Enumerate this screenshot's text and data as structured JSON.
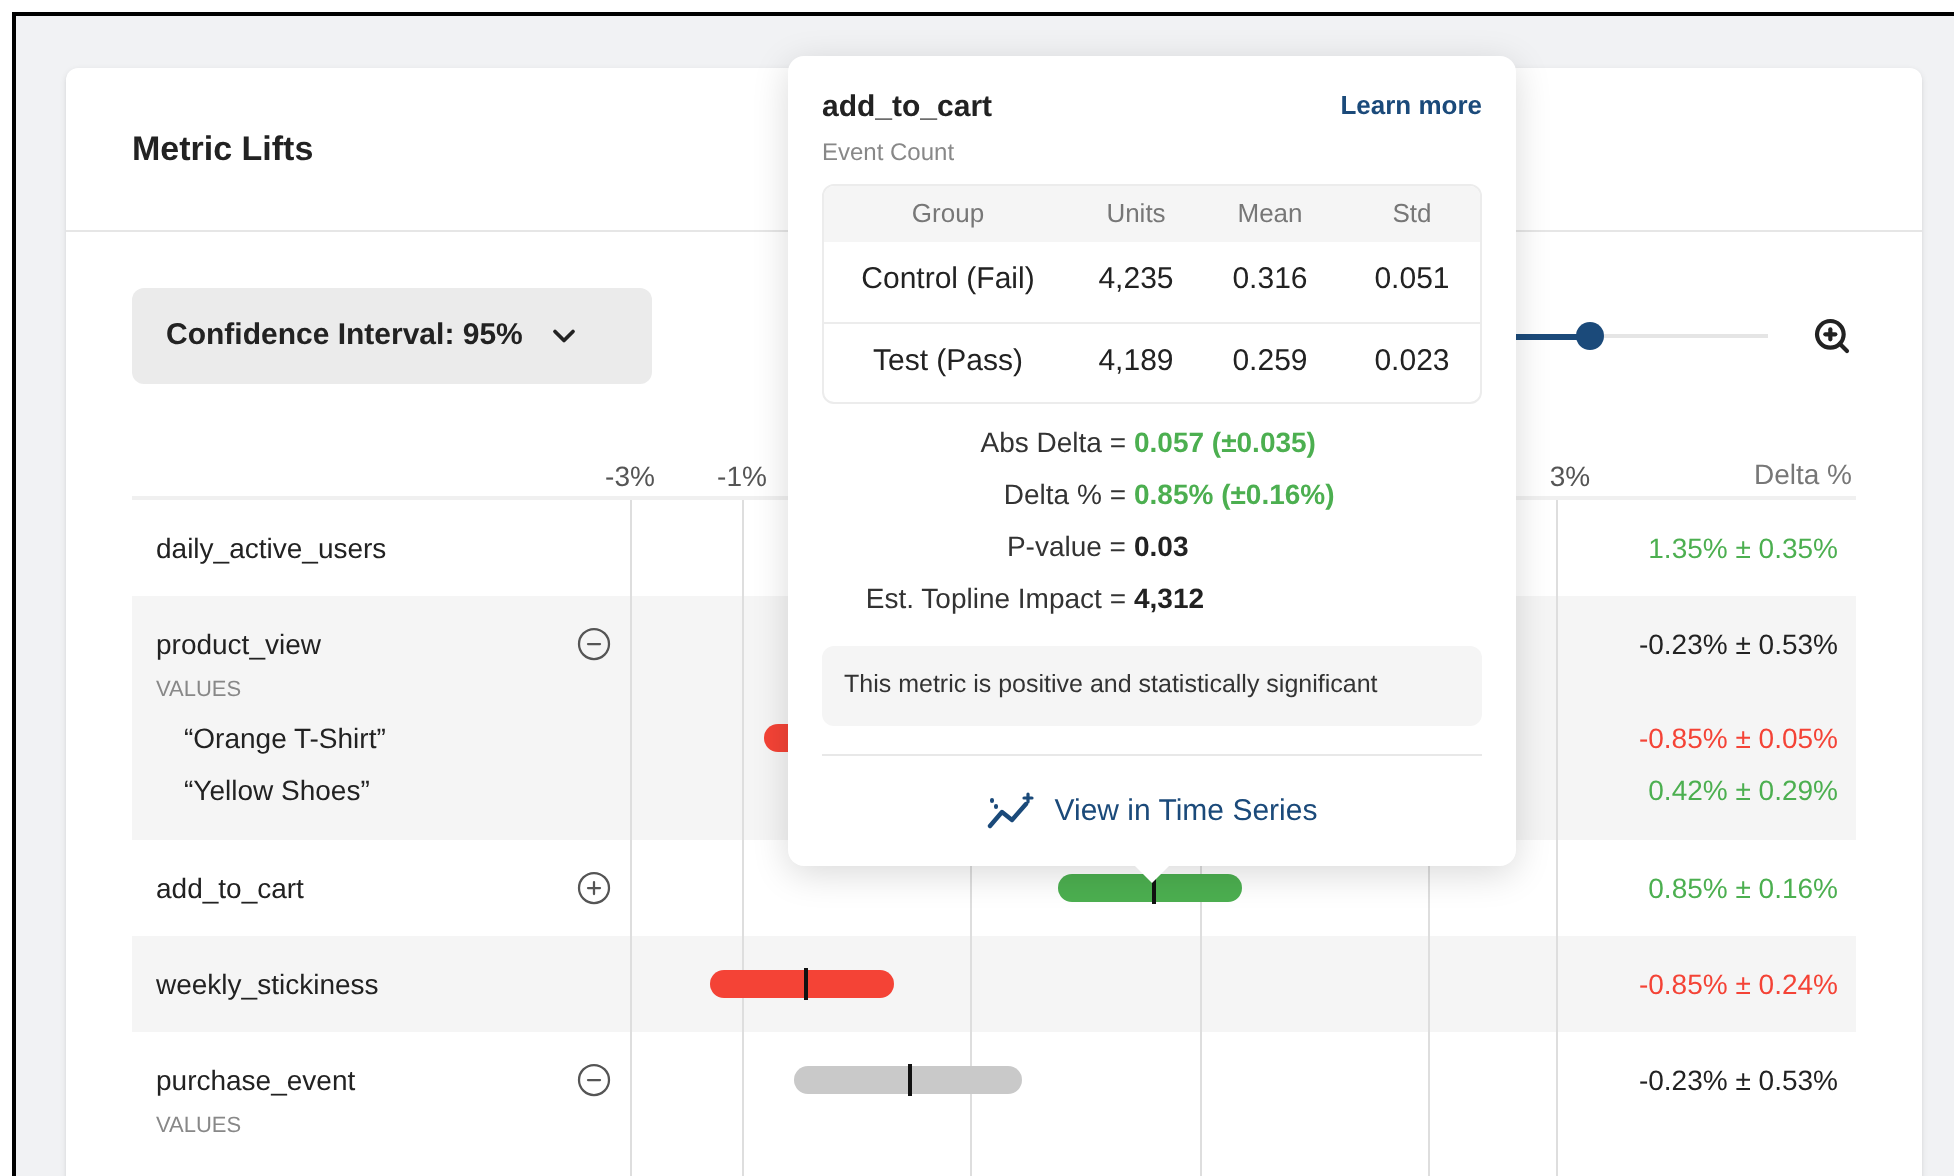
{
  "card": {
    "title": "Metric Lifts"
  },
  "confidence_dropdown": {
    "label": "Confidence Interval: 95%"
  },
  "zoom_slider": {
    "level": 0.68
  },
  "axis": {
    "ticks": [
      "-3%",
      "-1%",
      "3%"
    ],
    "delta_heading": "Delta %"
  },
  "rows": [
    {
      "name": "daily_active_users",
      "kind": "plain",
      "delta": "1.35% ± 0.35%",
      "color": "#4caf50"
    },
    {
      "name": "product_view",
      "kind": "group",
      "expanded": true,
      "delta": "-0.23% ± 0.53%",
      "color": "#222222",
      "values_label": "VALUES",
      "values": [
        {
          "name": "“Orange T-Shirt”",
          "delta": "-0.85% ± 0.05%",
          "color": "#f44336",
          "bar": {
            "color": "#f44336"
          }
        },
        {
          "name": "“Yellow Shoes”",
          "delta": "0.42% ± 0.29%",
          "color": "#4caf50"
        }
      ]
    },
    {
      "name": "add_to_cart",
      "kind": "group",
      "expanded": false,
      "delta": "0.85% ± 0.16%",
      "color": "#4caf50",
      "bar": {
        "color": "#4caf50"
      }
    },
    {
      "name": "weekly_stickiness",
      "kind": "plain",
      "delta": "-0.85% ± 0.24%",
      "color": "#f44336",
      "bar": {
        "color": "#f44336"
      }
    },
    {
      "name": "purchase_event",
      "kind": "group",
      "expanded": true,
      "delta": "-0.23% ± 0.53%",
      "color": "#222222",
      "bar": {
        "color": "#c9c9c9"
      },
      "values_label": "VALUES"
    }
  ],
  "popover": {
    "title": "add_to_cart",
    "link": "Learn more",
    "subtitle": "Event Count",
    "table": {
      "columns": [
        "Group",
        "Units",
        "Mean",
        "Std"
      ],
      "rows": [
        [
          "Control (Fail)",
          "4,235",
          "0.316",
          "0.051"
        ],
        [
          "Test (Pass)",
          "4,189",
          "0.259",
          "0.023"
        ]
      ]
    },
    "stats": [
      {
        "label": "Abs Delta =",
        "value": "0.057 (±0.035)",
        "color": "#4caf50"
      },
      {
        "label": "Delta % =",
        "value": "0.85% (±0.16%)",
        "color": "#4caf50"
      },
      {
        "label": "P-value =",
        "value": "0.03",
        "color": "#222222"
      },
      {
        "label": "Est. Topline Impact =",
        "value": "4,312",
        "color": "#222222"
      }
    ],
    "message": "This metric is positive and statistically significant",
    "action": "View in Time Series"
  }
}
